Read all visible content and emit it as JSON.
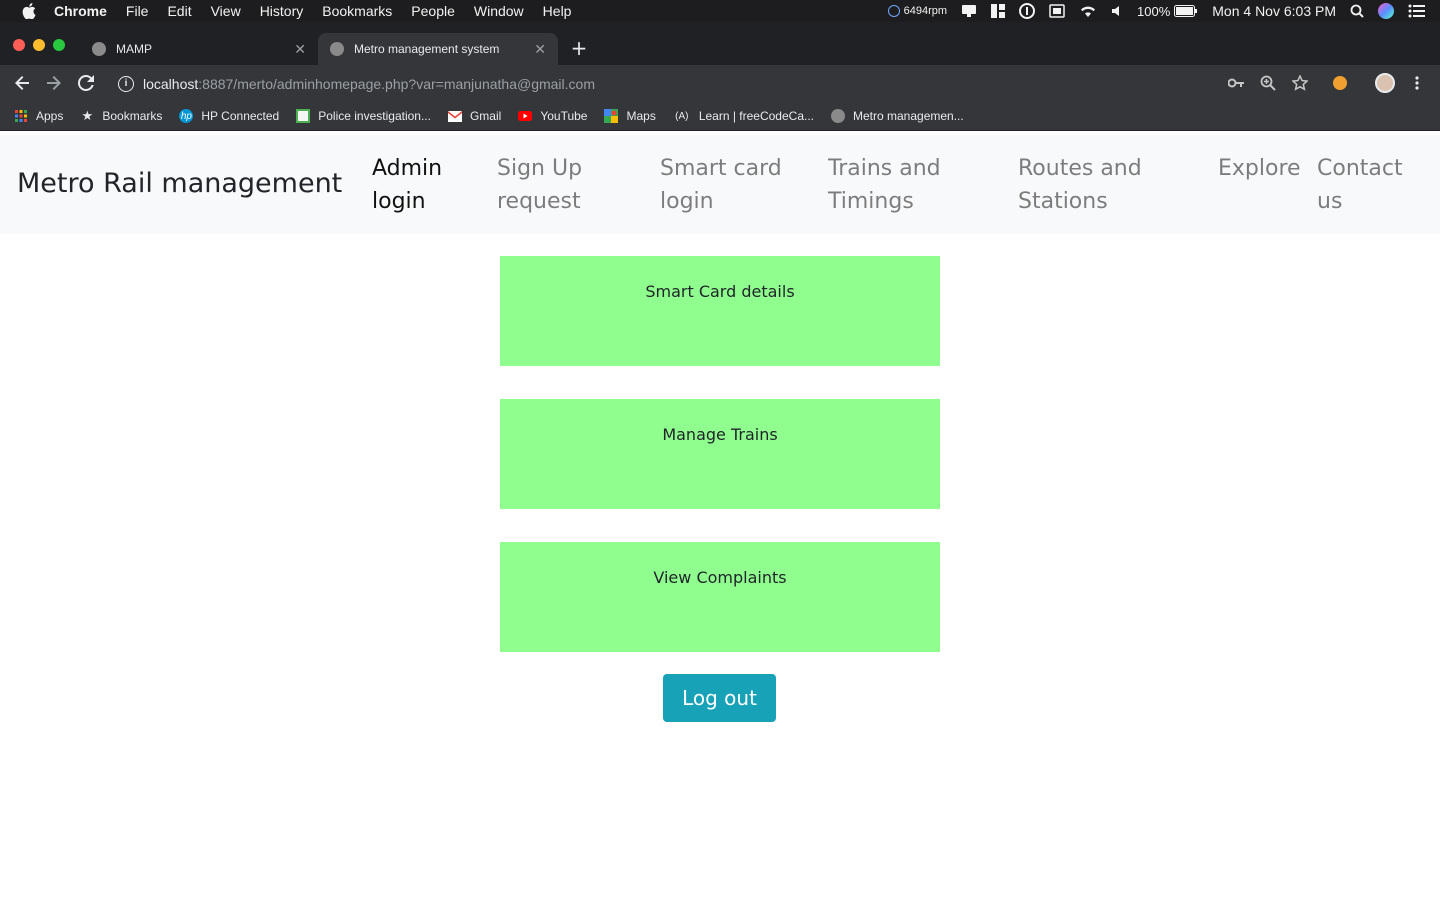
{
  "menubar": {
    "app": "Chrome",
    "items": [
      "File",
      "Edit",
      "View",
      "History",
      "Bookmarks",
      "People",
      "Window",
      "Help"
    ],
    "fan": "6494rpm",
    "battery": "100%",
    "clock": "Mon 4 Nov  6:03 PM"
  },
  "tabs": [
    {
      "title": "MAMP",
      "active": false
    },
    {
      "title": "Metro management system",
      "active": true
    }
  ],
  "toolbar": {
    "url_host": "localhost",
    "url_path": ":8887/merto/adminhomepage.php?var=manjunatha@gmail.com"
  },
  "bookmarks": [
    {
      "label": "Apps",
      "icon": "apps-grid-icon"
    },
    {
      "label": "Bookmarks",
      "icon": "star-icon"
    },
    {
      "label": "HP Connected",
      "icon": "hp-icon"
    },
    {
      "label": "Police investigation...",
      "icon": "doc-icon"
    },
    {
      "label": "Gmail",
      "icon": "gmail-icon"
    },
    {
      "label": "YouTube",
      "icon": "youtube-icon"
    },
    {
      "label": "Maps",
      "icon": "maps-icon"
    },
    {
      "label": "Learn | freeCodeCa...",
      "icon": "freecodecamp-icon"
    },
    {
      "label": "Metro managemen...",
      "icon": "page-icon"
    }
  ],
  "navbar": {
    "brand": "Metro Rail management",
    "links": [
      {
        "line1": "Admin",
        "line2": "login",
        "active": true
      },
      {
        "line1": "Sign Up",
        "line2": "request",
        "active": false
      },
      {
        "line1": "Smart card",
        "line2": "login",
        "active": false
      },
      {
        "line1": "Trains and",
        "line2": "Timings",
        "active": false
      },
      {
        "line1": "Routes and",
        "line2": "Stations",
        "active": false
      },
      {
        "line1": "Explore",
        "line2": "",
        "active": false
      },
      {
        "line1": "Contact",
        "line2": "us",
        "active": false
      }
    ]
  },
  "cards": [
    {
      "label": "Smart Card details"
    },
    {
      "label": "Manage Trains"
    },
    {
      "label": "View Complaints"
    }
  ],
  "logout_label": "Log out",
  "colors": {
    "card_bg": "#8ffe8f",
    "logout_bg": "#17a2b8",
    "navbar_bg": "#f8f9fa"
  }
}
